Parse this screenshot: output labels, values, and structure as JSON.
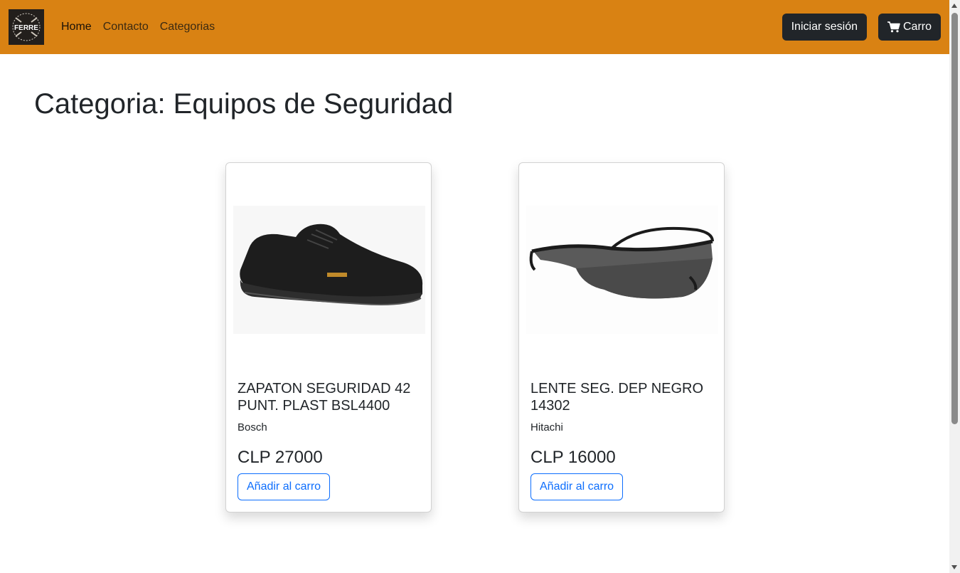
{
  "navbar": {
    "brand_icon": "ferre-logo",
    "logo_text": "FERRE",
    "links": [
      {
        "label": "Home",
        "active": true
      },
      {
        "label": "Contacto",
        "active": false
      },
      {
        "label": "Categorias",
        "active": false
      }
    ],
    "login_label": "Iniciar sesión",
    "cart_label": "Carro",
    "cart_icon": "shopping-cart-icon",
    "background": "#d98213"
  },
  "page": {
    "title": "Categoria: Equipos de Seguridad"
  },
  "products": [
    {
      "image": "safety-shoe-image",
      "title": "ZAPATON SEGURIDAD 42 PUNT. PLAST BSL4400",
      "brand": "Bosch",
      "price": "CLP 27000",
      "button_label": "Añadir al carro"
    },
    {
      "image": "safety-glasses-image",
      "title": "LENTE SEG. DEP NEGRO 14302",
      "brand": "Hitachi",
      "price": "CLP 16000",
      "button_label": "Añadir al carro"
    }
  ],
  "colors": {
    "primary": "#0d6efd",
    "dark": "#212529"
  }
}
